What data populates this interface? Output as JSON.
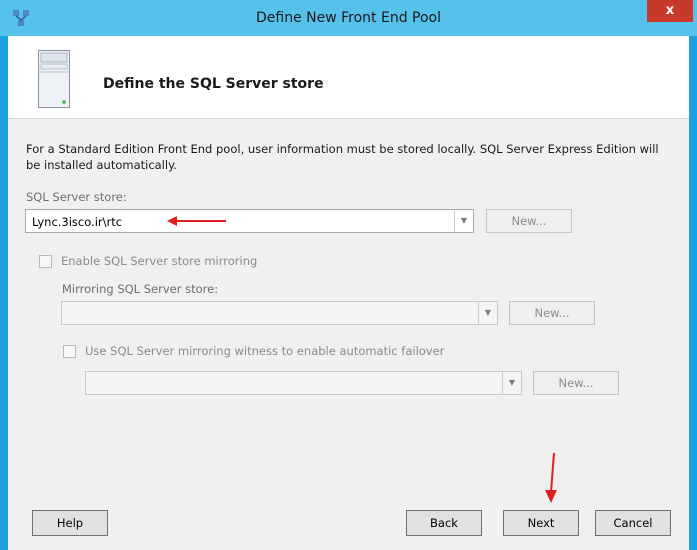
{
  "window": {
    "title": "Define New Front End Pool",
    "close_label": "x"
  },
  "header": {
    "title": "Define the SQL Server store"
  },
  "content": {
    "description": "For a Standard Edition Front End pool, user information must be stored locally.  SQL Server Express Edition will be installed automatically.",
    "sql_store": {
      "label": "SQL Server store:",
      "value": "Lync.3isco.ir\\rtc",
      "new_label": "New..."
    },
    "mirroring": {
      "checkbox_label": "Enable SQL Server store mirroring",
      "store_label": "Mirroring SQL Server store:",
      "store_value": "",
      "new_label": "New..."
    },
    "witness": {
      "checkbox_label": "Use SQL Server mirroring witness to enable automatic failover",
      "value": "",
      "new_label": "New..."
    }
  },
  "footer": {
    "help_label": "Help",
    "back_label": "Back",
    "next_label": "Next",
    "cancel_label": "Cancel"
  },
  "annotations": {
    "arrow_color": "#e02020"
  }
}
